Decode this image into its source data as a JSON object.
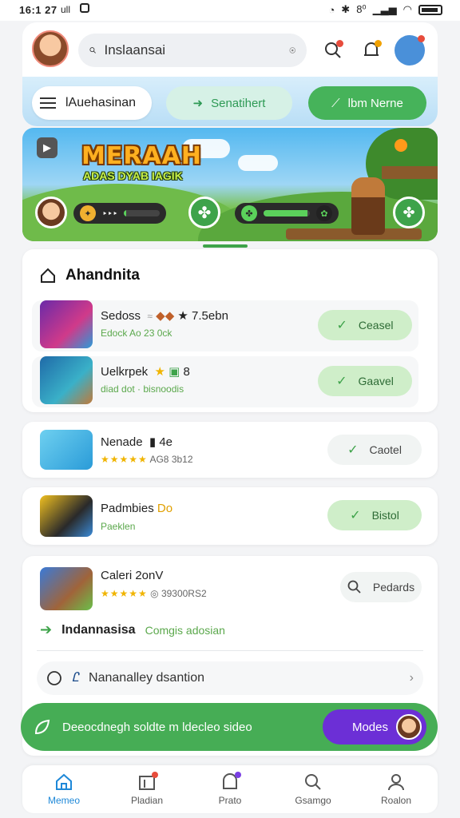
{
  "status_bar": {
    "time": "16:1 27",
    "signal": "ull",
    "bluetooth": "✱",
    "network": "8⁰",
    "wifi": "wifi-icon",
    "battery": "battery-icon"
  },
  "header": {
    "search_value": "Inslaansai",
    "menu_label": "lAuehasinan",
    "mid_pill_label": "Senatihert",
    "green_pill_label": "lbm Nerne"
  },
  "banner": {
    "title": "MERAAH",
    "subtitle": "ADAS DYAB IAGIK",
    "stat_left_label": "‣‣‣",
    "stat_left_progress": 0.05,
    "stat_right_label": "▬▬▬",
    "stat_right_progress": 0.95
  },
  "section": {
    "title": "Ahandnita",
    "items": [
      {
        "title": "Sedoss",
        "extra": "7.5ebn",
        "sub": "Edock Ao 23 0ck",
        "button": "Ceasel",
        "style": "green"
      },
      {
        "title": "Uelkrpek",
        "extra": "8",
        "sub": "diad dot · bisnoodis",
        "button": "Gaavel",
        "style": "green"
      }
    ]
  },
  "cards": [
    {
      "title": "Nenade",
      "extra": "4e",
      "rating_text": "AG8 3b12",
      "button": "Caotel",
      "style": "light"
    },
    {
      "title": "Padmbies",
      "extra": "Do",
      "sub": "Paeklen",
      "button": "Bistol",
      "style": "green"
    }
  ],
  "detail": {
    "title": "Caleri 2onV",
    "rating_text": "39300RS2",
    "button": "Pedards",
    "link_label": "Indannasisa",
    "link_sub": "Comgis adosian",
    "row_label": "Nananalley dsantion"
  },
  "action_bar": {
    "label": "Deeocdnegh soldte m ldecleo sideo",
    "more_label": "Modes"
  },
  "bottom_nav": [
    {
      "label": "Memeo",
      "icon": "home-icon",
      "active": true
    },
    {
      "label": "Pladian",
      "icon": "calendar-icon"
    },
    {
      "label": "Prato",
      "icon": "profile-icon"
    },
    {
      "label": "Gsamgo",
      "icon": "search-icon"
    },
    {
      "label": "Roalon",
      "icon": "user-icon"
    }
  ],
  "colors": {
    "accent_green": "#46ad55",
    "accent_purple": "#6c2fd6",
    "active_nav": "#1e88d8"
  }
}
